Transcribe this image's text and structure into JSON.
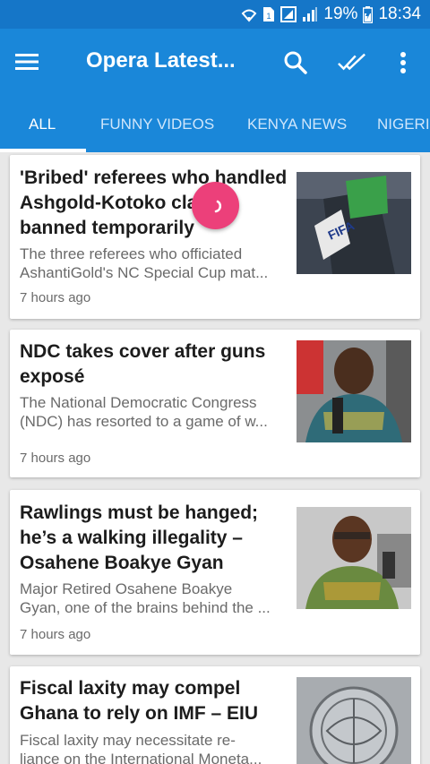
{
  "status_bar": {
    "battery": "19%",
    "time": "18:34",
    "icons": [
      "wifi-icon",
      "sim-icon",
      "data-icon",
      "signal-icon",
      "battery-icon"
    ]
  },
  "app_bar": {
    "title": "Opera Latest...",
    "icons": [
      "menu-icon",
      "search-icon",
      "double-check-icon",
      "more-vert-icon"
    ]
  },
  "tabs": [
    {
      "label": "ALL",
      "active": true
    },
    {
      "label": "FUNNY VIDEOS",
      "active": false
    },
    {
      "label": "KENYA NEWS",
      "active": false
    },
    {
      "label": "NIGERI",
      "active": false
    }
  ],
  "articles": [
    {
      "title": "'Bribed' referees who handled Ashgold-Kotoko clash banned temporarily",
      "summary": "The three referees who officiated\nAshantiGold's NC Special Cup mat...",
      "time": "7 hours ago"
    },
    {
      "title": "NDC takes cover after guns exposé",
      "summary": "The National Democratic Congress\n(NDC) has resorted to a game of w...",
      "time": "7 hours ago"
    },
    {
      "title": "Rawlings must be hanged; he’s a walking illegality – Osahene Boakye Gyan",
      "summary": "Major Retired Osahene Boakye\nGyan, one of the brains behind the ...",
      "time": "7 hours ago"
    },
    {
      "title": "Fiscal laxity may compel Ghana to rely on IMF – EIU",
      "summary": "Fiscal laxity may necessitate re-\nliance on the International Moneta...",
      "time": ""
    }
  ],
  "colors": {
    "status_bar": "#1576c8",
    "app_bar": "#1a87d9",
    "loader": "#ec407a"
  }
}
